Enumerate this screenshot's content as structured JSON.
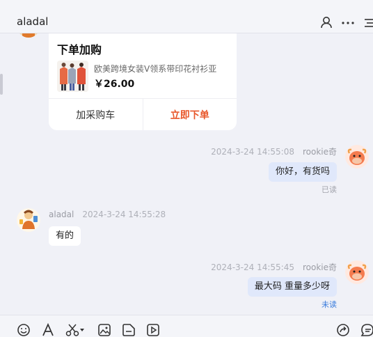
{
  "header": {
    "title": "aladal",
    "icons": [
      "user-icon",
      "more-icon",
      "list-icon"
    ]
  },
  "product_card": {
    "title": "下单加购",
    "product_name": "欧美跨境女装V领系带印花衬衫亚",
    "price": "￥26.00",
    "add_cart_label": "加采购车",
    "order_label": "立即下单",
    "order_color": "#e8572a"
  },
  "messages": [
    {
      "direction": "out",
      "time": "2024-3-24 14:55:08",
      "sender": "rookie奇",
      "text": "你好，有货吗",
      "status": "已读"
    },
    {
      "direction": "in",
      "time": "2024-3-24 14:55:28",
      "sender": "aladal",
      "text": "有的"
    },
    {
      "direction": "out",
      "time": "2024-3-24 14:55:45",
      "sender": "rookie奇",
      "text": "最大码 重量多少呀",
      "status": "未读"
    }
  ],
  "colors": {
    "outgoing_bubble": "#e0e8fb",
    "unread_status": "#3b7ddd",
    "background": "#f0f1f7"
  },
  "toolbar": {
    "icons": [
      "emoji-icon",
      "font-icon",
      "scissors-icon",
      "image-icon",
      "folder-icon",
      "video-icon",
      "share-icon",
      "quick-reply-icon"
    ]
  }
}
